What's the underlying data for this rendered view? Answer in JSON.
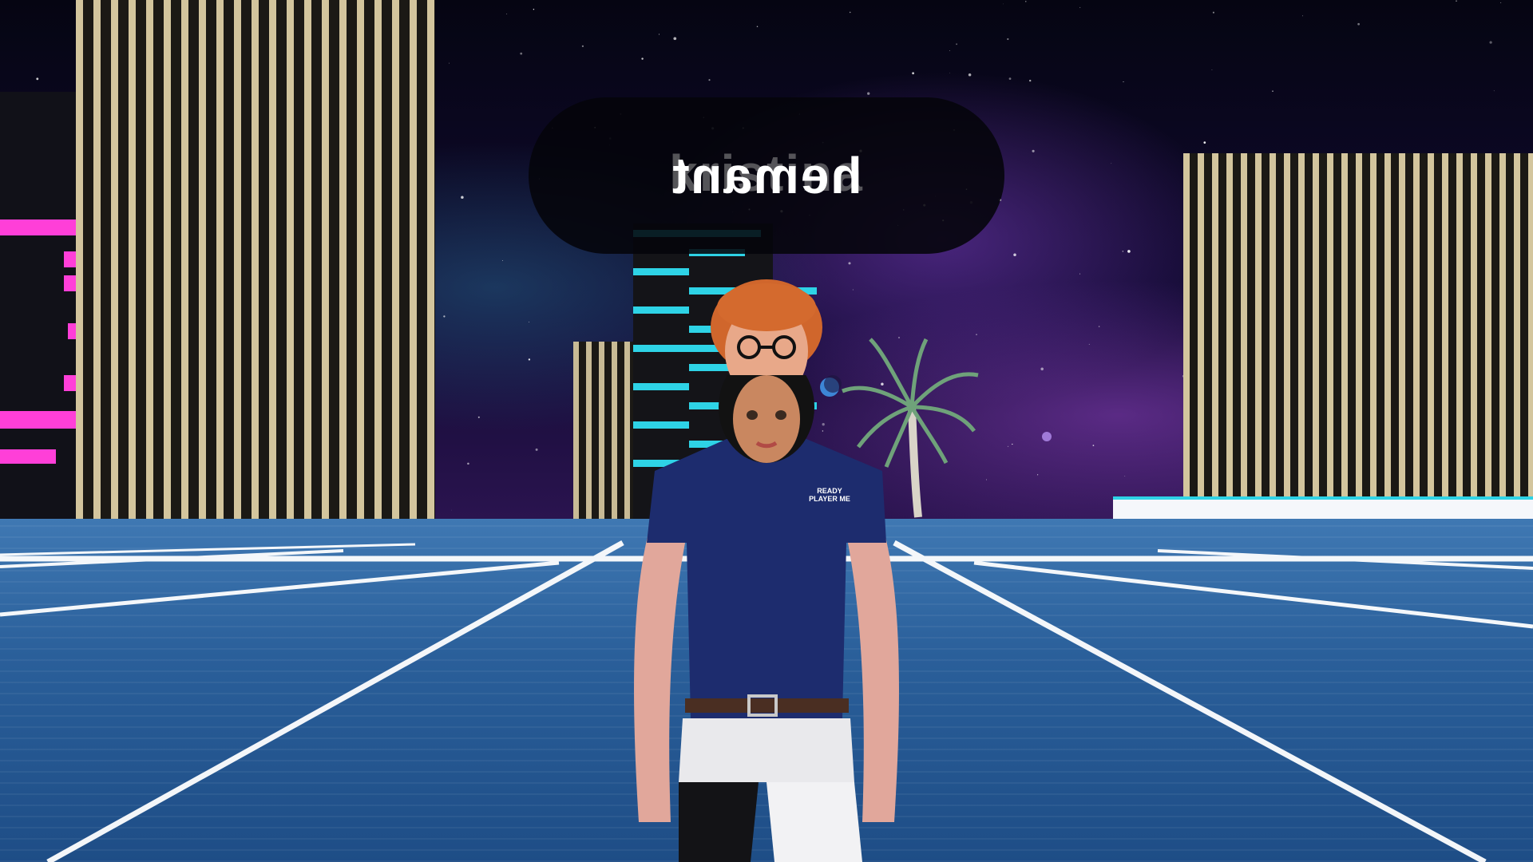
{
  "scene": {
    "nameplate": {
      "front_text": "hemant",
      "back_text": "kristina"
    },
    "shirt_logo_text": "READY PLAYER ME",
    "colors": {
      "neon_pink": "#ff3fd8",
      "neon_cyan": "#2ed3e6",
      "floor_blue": "#2f68a5",
      "window_light": "#f3e3b5",
      "shirt_navy": "#1d2c6e"
    },
    "icons": [
      "palm-tree-icon",
      "moon-icon",
      "star-icon"
    ]
  }
}
